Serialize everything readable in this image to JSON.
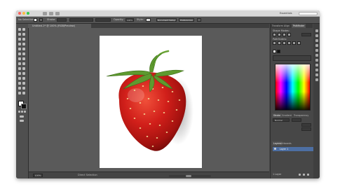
{
  "window": {
    "workspace_label": "Essentials"
  },
  "control_bar": {
    "selection_label": "No Selection",
    "stroke_label": "Stroke:",
    "opacity_label": "Opacity:",
    "opacity_value": "100%",
    "style_label": "Style:",
    "document_setup_label": "Document Setup",
    "preferences_label": "Preferences"
  },
  "document_tab": {
    "label": "Untitled-1* @ 100% (RGB/Preview)"
  },
  "status_bar": {
    "zoom": "100%",
    "tool_name": "Direct Selection"
  },
  "panels": {
    "tabs": [
      "Transform",
      "Align",
      "Pathfinder"
    ],
    "active_tab": "Pathfinder",
    "shape_modes_label": "Shape Modes:",
    "pathfinders_label": "Pathfinders:",
    "stroke_tab": "Stroke",
    "gradient_tab": "Gradient",
    "transparency_tab": "Transparency",
    "blend_mode": "Normal",
    "layers_tab": "Layers",
    "artboards_tab": "Artboards",
    "layer_name": "Layer 1",
    "layers_count": "1 Layer"
  },
  "colors": {
    "window_bg": "#4a4a4a",
    "canvas_bg": "#5a5a5a",
    "layer_highlight": "#4d6fa3"
  }
}
